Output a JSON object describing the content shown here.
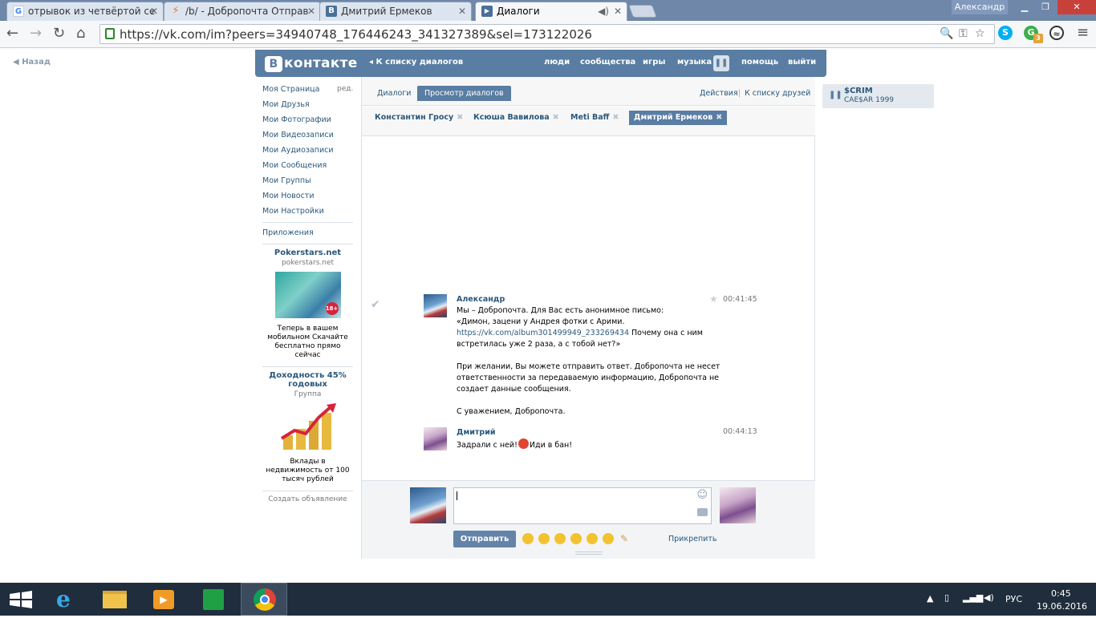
{
  "browser": {
    "tabs": [
      {
        "title": "отрывок из четвёртой се",
        "active": false
      },
      {
        "title": "/b/ - Добропочта Отправ",
        "active": false
      },
      {
        "title": "Дмитрий Ермеков",
        "active": false
      },
      {
        "title": "Диалоги",
        "active": true
      }
    ],
    "profile": "Александр",
    "url": "https://vk.com/im?peers=34940748_176446243_341327389&sel=173122026",
    "ext_badge": "3"
  },
  "vk": {
    "back": "Назад",
    "logo_text": "контакте",
    "head_back": "К списку диалогов",
    "nav": [
      "люди",
      "сообщества",
      "игры",
      "музыка",
      "помощь",
      "выйти"
    ],
    "menu": [
      "Моя Страница",
      "Мои Друзья",
      "Мои Фотографии",
      "Мои Видеозаписи",
      "Мои Аудиозаписи",
      "Мои Сообщения",
      "Мои Группы",
      "Мои Новости",
      "Мои Настройки"
    ],
    "menu_edit": "ред.",
    "apps": "Приложения",
    "ads": [
      {
        "title": "Pokerstars.net",
        "sub": "pokerstars.net",
        "text": "Теперь в вашем мобильном Скачайте бесплатно прямо сейчас"
      },
      {
        "title": "Доходность 45% годовых",
        "sub": "Группа",
        "text": "Вклады в недвижимость от 100 тысяч рублей"
      }
    ],
    "create_ad": "Создать объявление",
    "tabs": [
      "Диалоги",
      "Просмотр диалогов"
    ],
    "actions": "Действия",
    "friends_link": "К списку друзей",
    "peers": [
      "Константин Гросу",
      "Ксюша Вавилова",
      "Meti Baff",
      "Дмитрий Ермеков"
    ],
    "messages": [
      {
        "author": "Александр",
        "time": "00:41:45",
        "lines": [
          "Мы – Добропочта. Для Вас есть анонимное письмо:",
          "«Димон, зацени у Андрея фотки с Арими."
        ],
        "link": "https://vk.com/album301499949_233269434",
        "after_link": " Почему она с ним встретилась уже 2 раза, а с тобой нет?»",
        "p2": "При желании, Вы можете отправить ответ. Добропочта не несет ответственности за передаваемую информацию, Добропочта не создает данные сообщения.",
        "p3": "С уважением, Добропочта."
      },
      {
        "author": "Дмитрий",
        "time": "00:44:13",
        "before": "Задрали с ней!",
        "after": "Иди в бан!"
      }
    ],
    "send": "Отправить",
    "attach": "Прикрепить",
    "player": {
      "title": "$CRIM",
      "sub": "CAE$AR 1999"
    }
  },
  "taskbar": {
    "lang": "РУС",
    "time": "0:45",
    "date": "19.06.2016"
  },
  "colors": {
    "vk_blue": "#597DA3",
    "taskbar": "#1F2D3D",
    "win_title": "#6F87A9"
  }
}
